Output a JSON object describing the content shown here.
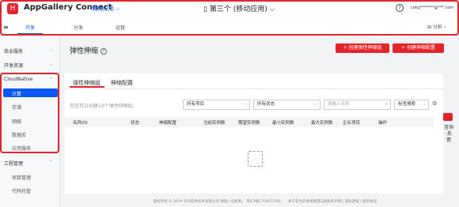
{
  "header": {
    "logo_text": "H",
    "brand": "AppGallery Connect",
    "my_apps": "我的应用",
    "project_name": "第三个 (移动应用)",
    "help_icon": "?",
    "account": "cokg*******@***.com"
  },
  "subnav": {
    "menu_icon": "≡",
    "tabs": [
      "开发",
      "分发",
      "运营"
    ],
    "analyze": "分析"
  },
  "sidebar": {
    "groups": [
      {
        "label": "商业服务"
      },
      {
        "label": "开发资源"
      },
      {
        "label": "CloudNative",
        "items": [
          "计算",
          "存储",
          "网络",
          "数据库",
          "应用服务"
        ]
      },
      {
        "label": "工程管理",
        "items": [
          "项目管理",
          "代码托管"
        ]
      }
    ]
  },
  "page": {
    "title": "弹性伸缩",
    "help_icon": "?",
    "create_group_btn": "+ 创建弹性伸缩组",
    "create_config_btn": "+ 创建伸缩配置",
    "tabs": [
      "弹性伸缩组",
      "伸缩配置"
    ],
    "hint": "您还可以创建10个弹性伸缩组。",
    "filters": {
      "project": "所有项目",
      "status": "所有状态",
      "search_placeholder": "请输入名称",
      "tag_search": "标签搜索"
    },
    "table_headers": [
      "名称/ID",
      "状态",
      "伸缩配置",
      "当前实例数",
      "期望实例数",
      "最小实例数",
      "最大实例数",
      "企业项目",
      "操作"
    ]
  },
  "float": {
    "label": "咨询·反馈"
  },
  "footer": "版权所有 © 2019 华为软件技术有限公司 保留一切权利。 苏ICP备17040376号　　关于华为开发者联盟与隐私的声明 | 隐私政策 | 服务协议",
  "colors": {
    "accent": "#0a59f7",
    "brand_red": "#e3242b"
  }
}
